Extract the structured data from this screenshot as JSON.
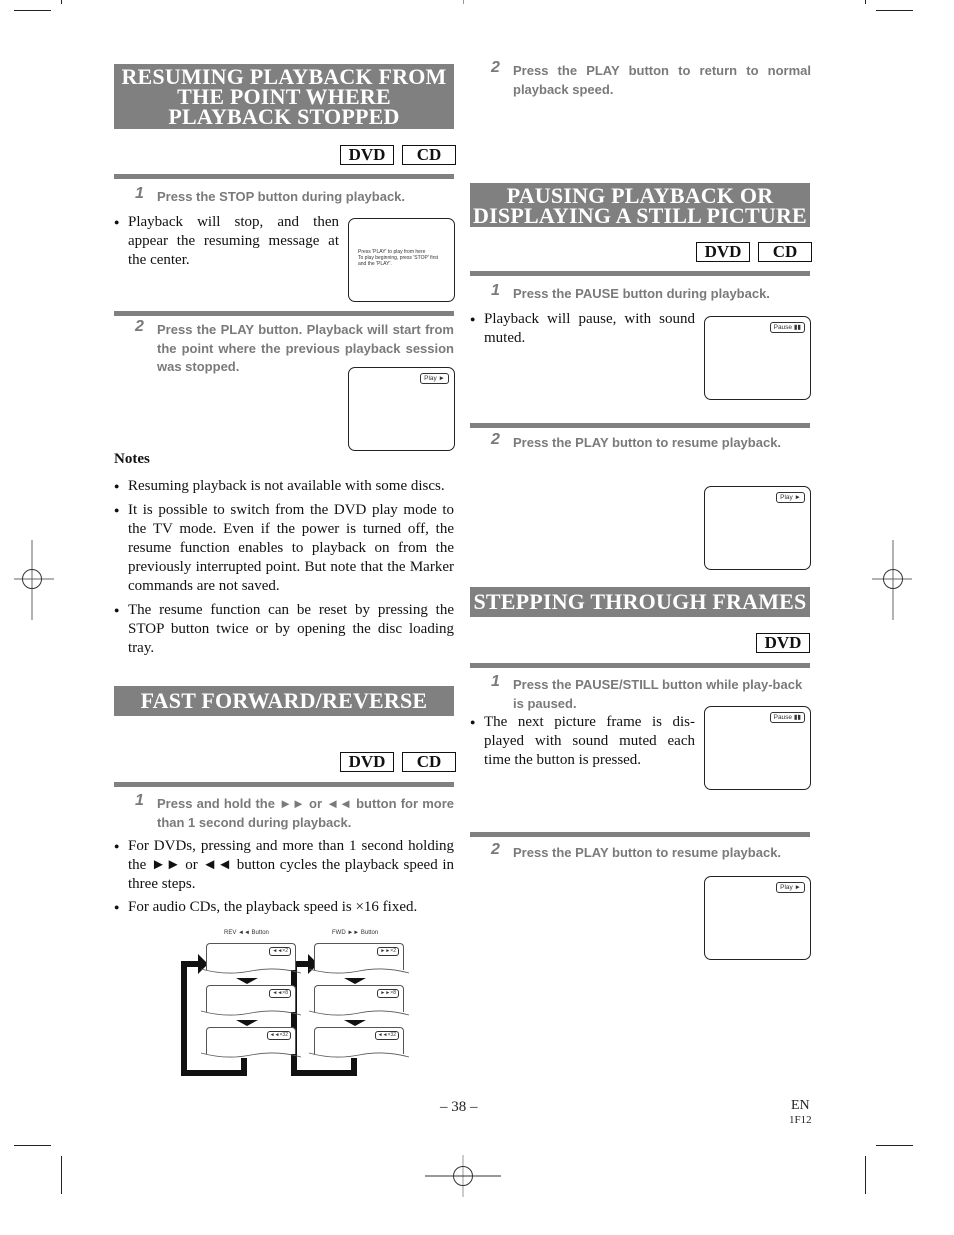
{
  "sections": {
    "resume": {
      "title_lines": [
        "RESUMING PLAYBACK FROM",
        "THE POINT WHERE",
        "PLAYBACK STOPPED"
      ],
      "tags": [
        "DVD",
        "CD"
      ],
      "step1": {
        "num": "1",
        "text": "Press the STOP button during playback."
      },
      "step1_bullet": "Playback will stop, and then appear the resuming message at the center.",
      "tv1_message_lines": [
        "Press 'PLAY' to play from here",
        "To play beginning, press 'STOP' first",
        "and the 'PLAY'."
      ],
      "step2": {
        "num": "2",
        "text": "Press the PLAY button. Playback will start from the point where the previous playback session was stopped."
      },
      "tv2_osd": "Play ►",
      "notes_heading": "Notes",
      "notes": [
        "Resuming playback is not available with some discs.",
        "It is possible to switch from the DVD play mode to the TV mode. Even if the power is turned off, the resume function enables to playback on from the previously interrupted point. But note that the Marker commands are not saved.",
        "The resume function can be reset by pressing the STOP button twice or by opening the disc loading tray."
      ]
    },
    "fastforward": {
      "title": "FAST FORWARD/REVERSE",
      "tags": [
        "DVD",
        "CD"
      ],
      "step1": {
        "num": "1",
        "text": "Press and hold the ►► or ◄◄ button for more than 1 second during playback."
      },
      "bullets": [
        "For DVDs, pressing and more than 1 second holding the ►► or ◄◄ button cycles the playback speed in three steps.",
        "For audio CDs, the playback speed is ×16 fixed."
      ],
      "diagram": {
        "rev_label": "REV ◄◄ Button",
        "fwd_label": "FWD ►► Button",
        "rev_speeds": [
          "◄◄×2",
          "◄◄×8",
          "◄◄×32"
        ],
        "fwd_speeds": [
          "►►×2",
          "►►×8",
          "◄◄×32"
        ]
      },
      "step2": {
        "num": "2",
        "text": "Press the PLAY button to return to normal playback speed."
      }
    },
    "pause": {
      "title_lines": [
        "PAUSING PLAYBACK OR",
        "DISPLAYING A STILL PICTURE"
      ],
      "tags": [
        "DVD",
        "CD"
      ],
      "step1": {
        "num": "1",
        "text": "Press the PAUSE button during playback."
      },
      "step1_bullet": "Playback will pause, with sound muted.",
      "tv1_osd": "Pause ▮▮",
      "step2": {
        "num": "2",
        "text": "Press the PLAY button to resume playback."
      },
      "tv2_osd": "Play ►"
    },
    "stepping": {
      "title": "STEPPING THROUGH FRAMES",
      "tags": [
        "DVD"
      ],
      "step1": {
        "num": "1",
        "text": "Press the PAUSE/STILL button while play-back is paused."
      },
      "step1_bullet": "The next picture frame is dis-played with sound muted each time the button is pressed.",
      "tv1_osd": "Pause ▮▮",
      "step2": {
        "num": "2",
        "text": "Press the PLAY button to resume playback."
      },
      "tv2_osd": "Play ►"
    }
  },
  "footer": {
    "page_number": "– 38 –",
    "lang": "EN",
    "code": "1F12"
  }
}
